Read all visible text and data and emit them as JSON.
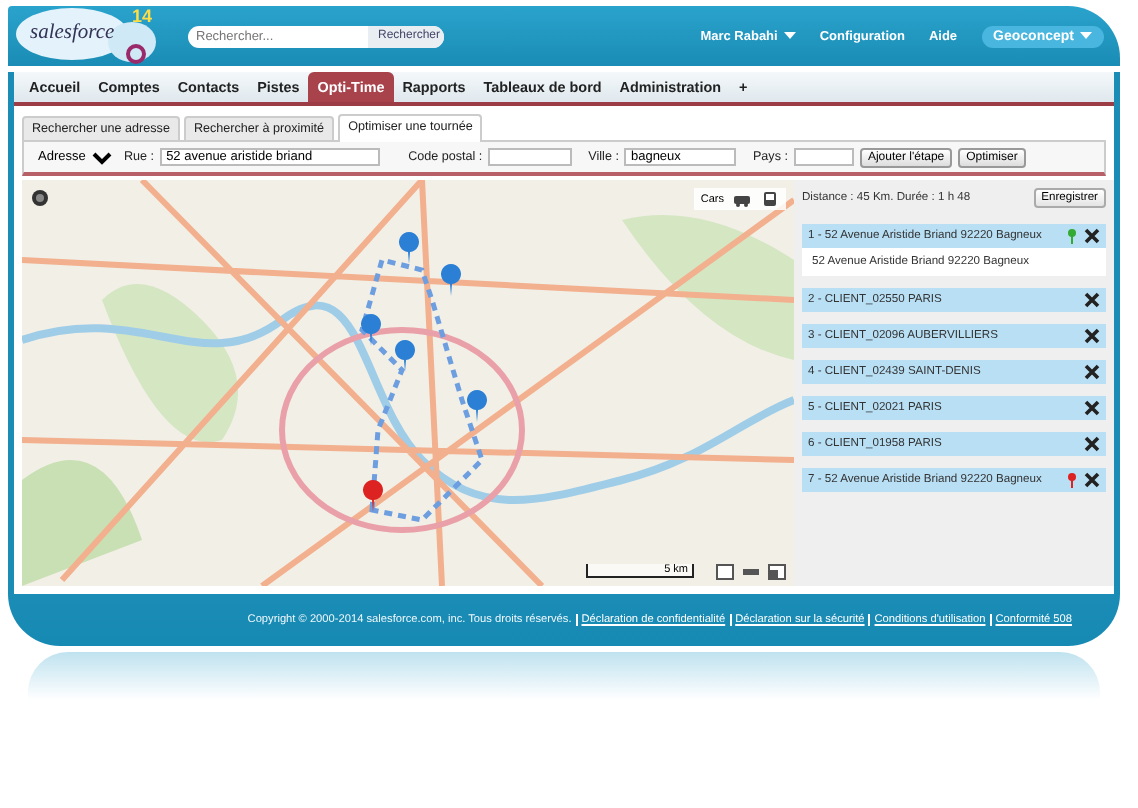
{
  "header": {
    "logo_text": "salesforce",
    "logo_badge": "14",
    "search": {
      "placeholder": "Rechercher..."
    },
    "search_button": "Rechercher",
    "user_menu": "Marc Rabahi",
    "links": [
      "Configuration",
      "Aide"
    ],
    "app_menu": "Geoconcept"
  },
  "tabs": [
    {
      "label": "Accueil",
      "selected": false
    },
    {
      "label": "Comptes",
      "selected": false
    },
    {
      "label": "Contacts",
      "selected": false
    },
    {
      "label": "Pistes",
      "selected": false
    },
    {
      "label": "Opti-Time",
      "selected": true
    },
    {
      "label": "Rapports",
      "selected": false
    },
    {
      "label": "Tableaux de bord",
      "selected": false
    },
    {
      "label": "Administration",
      "selected": false
    },
    {
      "label": "+",
      "selected": false
    }
  ],
  "subtabs": [
    {
      "label": "Rechercher une adresse",
      "selected": false
    },
    {
      "label": "Rechercher à proximité",
      "selected": false
    },
    {
      "label": "Optimiser une tournée",
      "selected": true
    }
  ],
  "form": {
    "type_select": "Adresse",
    "fields": [
      {
        "label": "Rue :",
        "value": "52 avenue aristide briand"
      },
      {
        "label": "Code postal :"
      },
      {
        "label": "Ville :",
        "value": "bagneux"
      },
      {
        "label": "Pays :"
      }
    ],
    "buttons": [
      "Ajouter l'étape",
      "Optimiser"
    ]
  },
  "map": {
    "transport_mode": "Cars",
    "scale": "5 km"
  },
  "route": {
    "summary": "Distance : 45 Km. Durée : 1 h 48",
    "save_button": "Enregistrer",
    "stops": [
      {
        "kind": "start",
        "label": "1 - 52 Avenue Aristide Briand 92220 Bagneux",
        "detail": "52 Avenue Aristide Briand 92220 Bagneux"
      },
      {
        "kind": "client",
        "label": "2 - CLIENT_02550 PARIS"
      },
      {
        "kind": "client",
        "label": "3 - CLIENT_02096 AUBERVILLIERS"
      },
      {
        "kind": "client",
        "label": "4 - CLIENT_02439 SAINT-DENIS"
      },
      {
        "kind": "client",
        "label": "5 - CLIENT_02021 PARIS"
      },
      {
        "kind": "client",
        "label": "6 - CLIENT_01958 PARIS"
      },
      {
        "kind": "end",
        "label": "7 - 52 Avenue Aristide Briand 92220 Bagneux"
      }
    ]
  },
  "footer": {
    "copyright": "Copyright © 2000-2014 salesforce.com, inc. Tous droits réservés.",
    "links": [
      "Déclaration de confidentialité",
      "Déclaration sur la sécurité",
      "Conditions d'utilisation",
      "Conformité 508"
    ]
  }
}
